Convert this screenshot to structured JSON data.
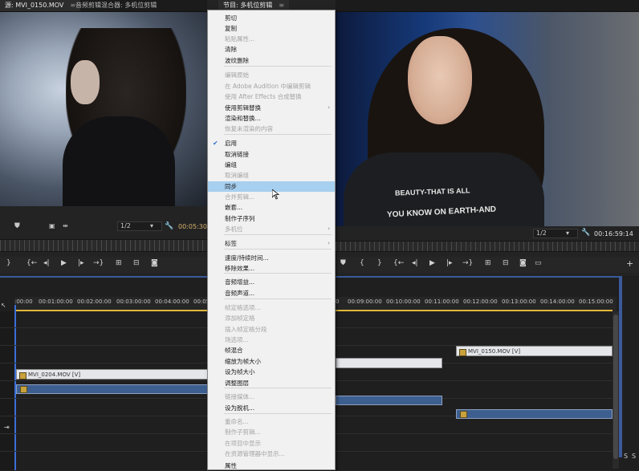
{
  "source_panel": {
    "tabs": [
      {
        "label": "源: MVI_0150.MOV",
        "menu": "≡"
      },
      {
        "label": "音频剪辑混合器: 多机位剪辑",
        "menu": ""
      }
    ],
    "resolution": "1/2",
    "timecode": "00:05:30"
  },
  "program_panel": {
    "tab": {
      "label": "节目: 多机位剪辑",
      "menu": "≡"
    },
    "resolution": "1/2",
    "timecode": "00:16:59:14",
    "shirt_text": [
      "BEAUTY-THAT IS ALL",
      "YOU KNOW ON EARTH-AND"
    ]
  },
  "timeline": {
    "ruler_left": [
      ":00:00",
      "00:01:00:00",
      "00:02:00:00",
      "00:03:00:00",
      "00:04:00:00",
      "00:05"
    ],
    "ruler_right": [
      "0",
      "00:09:00:00",
      "00:10:00:00",
      "00:11:00:00",
      "00:12:00:00",
      "00:13:00:00",
      "00:14:00:00",
      "00:15:00:00"
    ],
    "clips": [
      {
        "label": "MVI_0204.MOV [V]"
      },
      {
        "label": "MVI_0150.MOV [V]"
      }
    ],
    "scroll_labels": [
      "S",
      "S"
    ]
  },
  "context_menu": {
    "items": [
      {
        "label": "剪切",
        "disabled": false
      },
      {
        "label": "复制",
        "disabled": false
      },
      {
        "label": "粘贴属性...",
        "disabled": true
      },
      {
        "label": "清除",
        "disabled": false
      },
      {
        "label": "波纹删除",
        "disabled": false
      },
      {
        "label": "编辑原始",
        "disabled": true
      },
      {
        "label": "在 Adobe Audition 中编辑剪辑",
        "disabled": true
      },
      {
        "label": "使用 After Effects 合成替换",
        "disabled": true
      },
      {
        "label": "使用剪辑替换",
        "disabled": false,
        "submenu": "›"
      },
      {
        "label": "渲染和替换...",
        "disabled": false
      },
      {
        "label": "恢复未渲染的内容",
        "disabled": true
      },
      {
        "label": "启用",
        "disabled": false,
        "checked": "✔"
      },
      {
        "label": "取消链接",
        "disabled": false
      },
      {
        "label": "编组",
        "disabled": false
      },
      {
        "label": "取消编组",
        "disabled": true
      },
      {
        "label": "同步",
        "disabled": false,
        "highlighted": true
      },
      {
        "label": "合并剪辑...",
        "disabled": true
      },
      {
        "label": "嵌套...",
        "disabled": false
      },
      {
        "label": "制作子序列",
        "disabled": false
      },
      {
        "label": "多机位",
        "disabled": true,
        "submenu": "›"
      },
      {
        "label": "标签",
        "disabled": false,
        "submenu": "›"
      },
      {
        "label": "速度/持续时间...",
        "disabled": false
      },
      {
        "label": "移除效果...",
        "disabled": false
      },
      {
        "label": "音频增益...",
        "disabled": false
      },
      {
        "label": "音频声道...",
        "disabled": false
      },
      {
        "label": "帧定格选项...",
        "disabled": true
      },
      {
        "label": "添加帧定格",
        "disabled": true
      },
      {
        "label": "插入帧定格分段",
        "disabled": true
      },
      {
        "label": "场选项...",
        "disabled": true
      },
      {
        "label": "帧混合",
        "disabled": false
      },
      {
        "label": "缩放为帧大小",
        "disabled": false
      },
      {
        "label": "设为帧大小",
        "disabled": false
      },
      {
        "label": "调整图层",
        "disabled": false
      },
      {
        "label": "链接媒体...",
        "disabled": true
      },
      {
        "label": "设为脱机...",
        "disabled": false
      },
      {
        "label": "重命名...",
        "disabled": true
      },
      {
        "label": "制作子剪辑...",
        "disabled": true
      },
      {
        "label": "在项目中显示",
        "disabled": true
      },
      {
        "label": "在资源管理器中显示...",
        "disabled": true
      },
      {
        "label": "属性",
        "disabled": false
      }
    ]
  }
}
